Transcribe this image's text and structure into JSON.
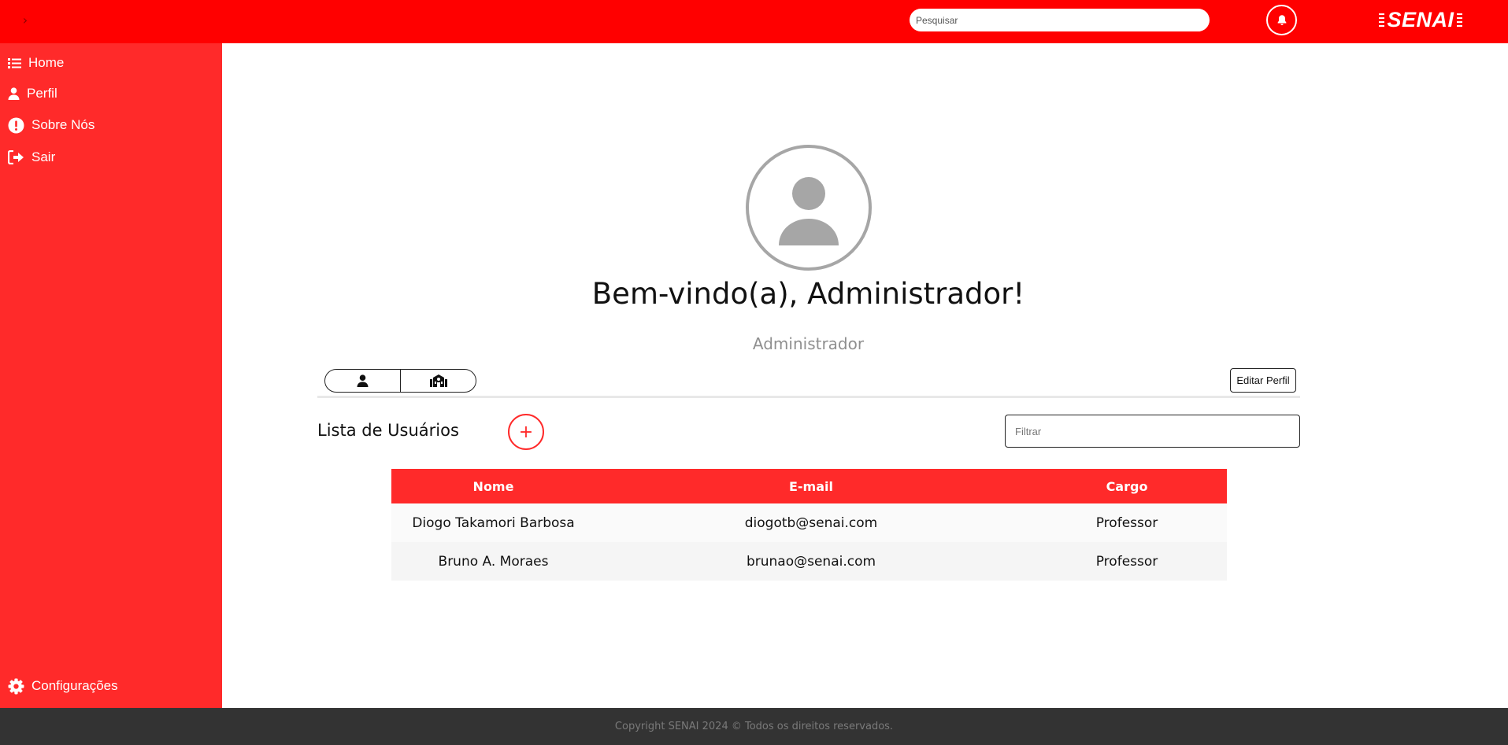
{
  "topbar": {
    "search_placeholder": "Pesquisar",
    "logo_text": "SENAI",
    "menu_toggle_glyph": "›",
    "bell_icon": "bell-icon"
  },
  "sidebar": {
    "items": [
      {
        "label": "Home",
        "icon": "list-icon"
      },
      {
        "label": "Perfil",
        "icon": "user-icon"
      },
      {
        "label": "Sobre Nós",
        "icon": "exclamation-circle-icon"
      },
      {
        "label": "Sair",
        "icon": "sign-out-icon"
      }
    ],
    "settings": {
      "label": "Configurações",
      "icon": "gear-icon"
    }
  },
  "profile": {
    "welcome": "Bem-vindo(a), Administrador!",
    "role": "Administrador",
    "tabs": [
      {
        "icon": "user-icon"
      },
      {
        "icon": "school-icon"
      }
    ],
    "edit_label": "Editar Perfil"
  },
  "users": {
    "title": "Lista de Usuários",
    "add_label": "+",
    "filter_placeholder": "Filtrar",
    "columns": [
      "Nome",
      "E-mail",
      "Cargo"
    ],
    "rows": [
      [
        "Diogo Takamori Barbosa",
        "diogotb@senai.com",
        "Professor"
      ],
      [
        "Bruno A. Moraes",
        "brunao@senai.com",
        "Professor"
      ]
    ]
  },
  "footer": {
    "text": "Copyright SENAI 2024 © Todos os direitos reservados."
  },
  "colors": {
    "topbar": "#ff0000",
    "sidebar": "#ff2a2a",
    "table_header": "#ff2a2a",
    "footer": "#333333",
    "avatar": "#a6a6a6"
  }
}
